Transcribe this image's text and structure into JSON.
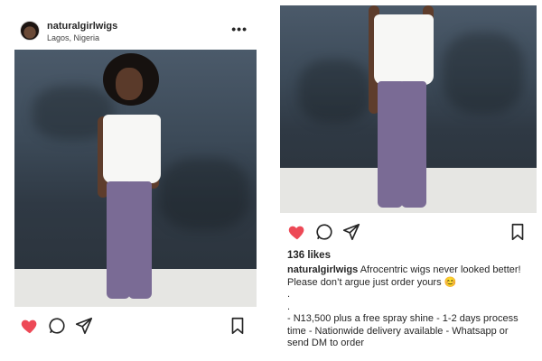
{
  "left_post": {
    "username": "naturalgirlwigs",
    "location": "Lagos, Nigeria",
    "more_icon": "more-horizontal-icon",
    "more_glyph": "•••",
    "actions": {
      "liked": true,
      "like_color": "#ed4956"
    }
  },
  "right_post": {
    "actions": {
      "liked": true,
      "like_color": "#ed4956"
    },
    "likes": "136 likes",
    "caption": {
      "username": "naturalgirlwigs",
      "text": " Afrocentric wigs never looked better! Please don’t argue just order yours 😊",
      "dot1": ".",
      "dot2": ".",
      "details": "- N13,500 plus a free spray shine - 1-2 days process time - Nationwide delivery available - Whatsapp or send DM to order"
    }
  }
}
